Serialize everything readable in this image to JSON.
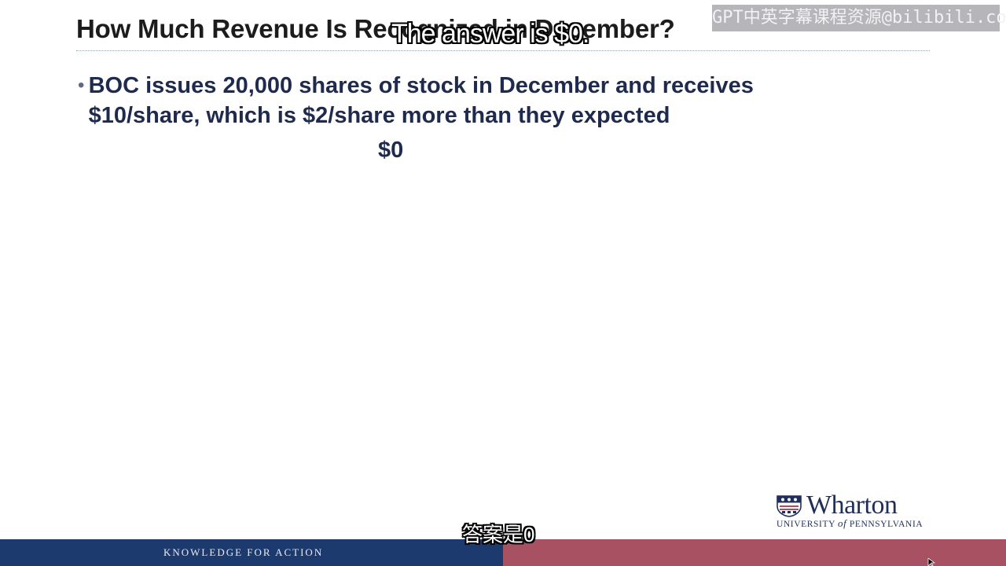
{
  "slide": {
    "title": "How Much Revenue Is Recognized in December?",
    "bullet": "BOC issues 20,000 shares of stock in December and receives $10/share, which is $2/share more than they expected",
    "answer": "$0"
  },
  "subtitles": {
    "english": "The answer is $0.",
    "chinese": "答案是0"
  },
  "watermark": "GPT中英字幕课程资源@bilibili.com",
  "logo": {
    "name": "Wharton",
    "university_prefix": "UNIVERSITY ",
    "university_of": "of",
    "university_suffix": " PENNSYLVANIA"
  },
  "footer": {
    "tagline": "KNOWLEDGE FOR ACTION"
  },
  "colors": {
    "footer_left": "#1d3a6e",
    "footer_right": "#a85163",
    "title_text": "#1c1c1c",
    "body_text": "#1f2a4f"
  },
  "icons": {
    "logo": "penn-shield-icon",
    "cursor": "mouse-cursor-icon",
    "bullet": "bullet-dot-icon"
  }
}
